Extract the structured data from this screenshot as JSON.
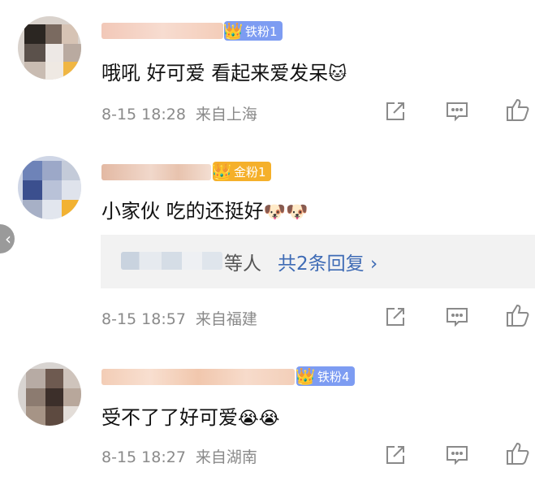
{
  "comments": [
    {
      "badge": "铁粉1",
      "text": "哦吼 好可爱 看起来爱发呆",
      "emojis": [
        "🐱"
      ],
      "time": "8-15 18:28",
      "location": "来自上海"
    },
    {
      "badge": "金粉1",
      "text": "小家伙 吃的还挺好",
      "emojis": [
        "🐶",
        "🐶"
      ],
      "time": "8-15 18:57",
      "location": "来自福建",
      "replies": {
        "suffix": "等人",
        "count_label": "共2条回复 ›"
      }
    },
    {
      "badge": "铁粉4",
      "text": "受不了了好可爱",
      "emojis": [
        "😭",
        "😭"
      ],
      "time": "8-15 18:27",
      "location": "来自湖南"
    }
  ],
  "icons": {
    "share": "share-icon",
    "comment": "comment-icon",
    "like": "like-icon",
    "crown": "crown-icon",
    "back": "chevron-left-icon"
  },
  "colors": {
    "iron_badge": "#7d9cf2",
    "gold_badge": "#f5b02a",
    "reply_link": "#3e6bb5",
    "meta_text": "#8a8a8a"
  },
  "side_tab": "‹"
}
